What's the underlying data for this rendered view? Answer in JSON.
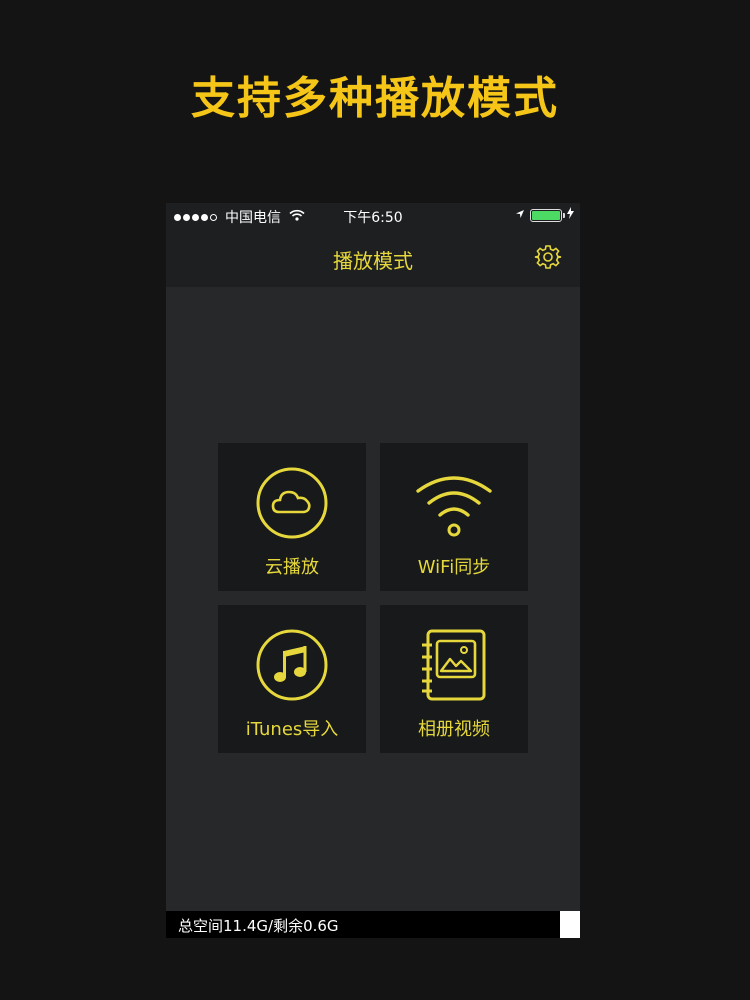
{
  "promo": {
    "title": "支持多种播放模式"
  },
  "status_bar": {
    "carrier": "中国电信",
    "time": "下午6:50",
    "battery_color": "#4cd964"
  },
  "nav": {
    "title": "播放模式",
    "settings_icon": "gear-icon"
  },
  "modes": [
    {
      "label": "云播放",
      "icon": "cloud-icon"
    },
    {
      "label": "WiFi同步",
      "icon": "wifi-icon"
    },
    {
      "label": "iTunes导入",
      "icon": "music-note-icon"
    },
    {
      "label": "相册视频",
      "icon": "photo-album-icon"
    }
  ],
  "footer": {
    "storage_text": "总空间11.4G/剩余0.6G"
  },
  "colors": {
    "accent": "#e6d83c",
    "promo_accent": "#f5c518",
    "background": "#141414",
    "phone_bg": "#26282a",
    "tile_bg": "#17191a"
  }
}
